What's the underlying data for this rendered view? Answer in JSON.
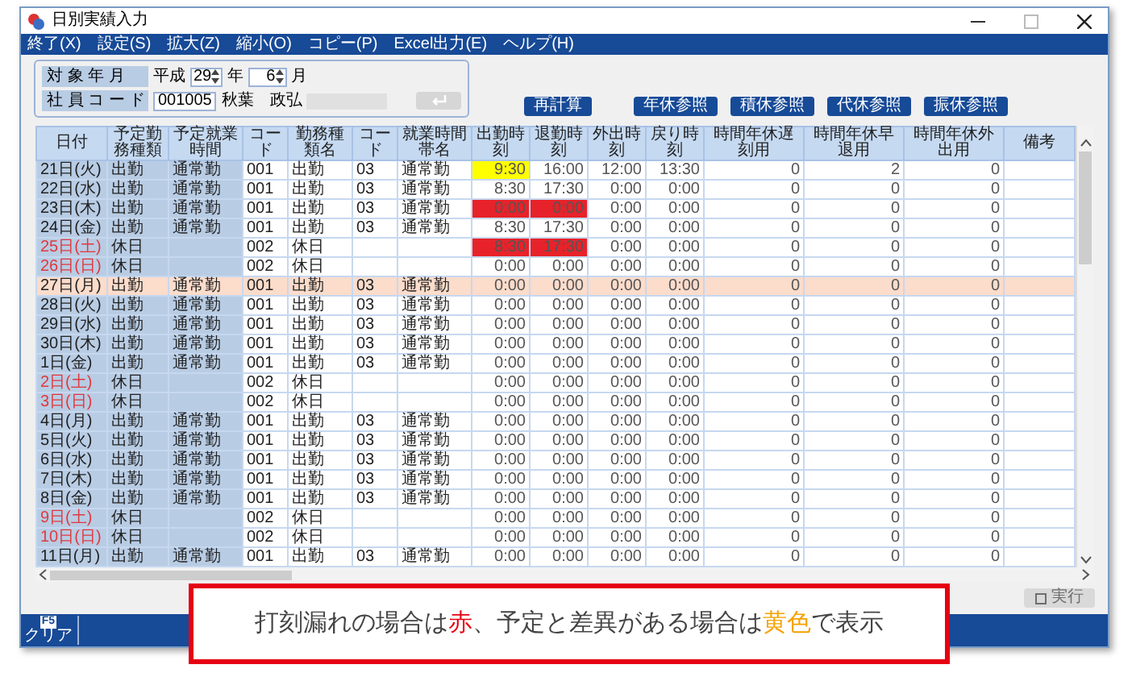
{
  "window": {
    "title": "日別実績入力"
  },
  "menu": [
    "終了(X)",
    "設定(S)",
    "拡大(Z)",
    "縮小(O)",
    "コピー(P)",
    "Excel出力(E)",
    "ヘルプ(H)"
  ],
  "form": {
    "period_label": "対 象 年 月",
    "era": "平成",
    "year": "29",
    "year_unit": "年",
    "month": "6",
    "month_unit": "月",
    "employee_label": "社 員 コ ー ド",
    "employee_code": "001005",
    "employee_name": "秋葉　政弘",
    "enter_button": {
      "disabled": true
    }
  },
  "recalc_button": {
    "label": "再計算"
  },
  "reference_buttons": [
    {
      "label": "年休参照"
    },
    {
      "label": "積休参照"
    },
    {
      "label": "代休参照"
    },
    {
      "label": "振休参照"
    }
  ],
  "table": {
    "columns": [
      "日付",
      "予定勤務種類",
      "予定就業時間",
      "コード",
      "勤務種類名",
      "コード",
      "就業時間帯名",
      "出勤時刻",
      "退勤時刻",
      "外出時刻",
      "戻り時刻",
      "時間年休遅刻用",
      "時間年休早退用",
      "時間年休外出用",
      "備考"
    ],
    "rows": [
      {
        "date": "21日(火)",
        "holiday": false,
        "selected": false,
        "plan_type": "出勤",
        "plan_hours": "通常勤",
        "code": "001",
        "type_name": "出勤",
        "hours_code": "03",
        "hours_name": "通常勤",
        "clock_in": "9:30",
        "clock_in_mismatch": true,
        "clock_out": "16:00",
        "out_time": "12:00",
        "return_time": "13:30",
        "late": "0",
        "early": "2",
        "outing": "0"
      },
      {
        "date": "22日(水)",
        "holiday": false,
        "selected": false,
        "plan_type": "出勤",
        "plan_hours": "通常勤",
        "code": "001",
        "type_name": "出勤",
        "hours_code": "03",
        "hours_name": "通常勤",
        "clock_in": "8:30",
        "clock_out": "17:30",
        "out_time": "0:00",
        "return_time": "0:00",
        "late": "0",
        "early": "0",
        "outing": "0"
      },
      {
        "date": "23日(木)",
        "holiday": false,
        "selected": false,
        "plan_type": "出勤",
        "plan_hours": "通常勤",
        "code": "001",
        "type_name": "出勤",
        "hours_code": "03",
        "hours_name": "通常勤",
        "clock_in": "0:00",
        "clock_in_missing": true,
        "clock_out": "0:00",
        "clock_out_missing": true,
        "out_time": "0:00",
        "return_time": "0:00",
        "late": "0",
        "early": "0",
        "outing": "0"
      },
      {
        "date": "24日(金)",
        "holiday": false,
        "selected": false,
        "plan_type": "出勤",
        "plan_hours": "通常勤",
        "code": "001",
        "type_name": "出勤",
        "hours_code": "03",
        "hours_name": "通常勤",
        "clock_in": "8:30",
        "clock_out": "17:30",
        "out_time": "0:00",
        "return_time": "0:00",
        "late": "0",
        "early": "0",
        "outing": "0"
      },
      {
        "date": "25日(土)",
        "holiday": true,
        "selected": false,
        "plan_type": "休日",
        "code": "002",
        "type_name": "休日",
        "clock_in": "8:30",
        "clock_in_missing": true,
        "clock_out": "17:30",
        "clock_out_missing": true,
        "out_time": "0:00",
        "return_time": "0:00",
        "late": "0",
        "early": "0",
        "outing": "0"
      },
      {
        "date": "26日(日)",
        "holiday": true,
        "selected": false,
        "plan_type": "休日",
        "code": "002",
        "type_name": "休日",
        "clock_in": "0:00",
        "clock_out": "0:00",
        "out_time": "0:00",
        "return_time": "0:00",
        "late": "0",
        "early": "0",
        "outing": "0"
      },
      {
        "date": "27日(月)",
        "holiday": false,
        "selected": true,
        "plan_type": "出勤",
        "plan_hours": "通常勤",
        "code": "001",
        "type_name": "出勤",
        "hours_code": "03",
        "hours_name": "通常勤",
        "clock_in": "0:00",
        "clock_out": "0:00",
        "out_time": "0:00",
        "return_time": "0:00",
        "late": "0",
        "early": "0",
        "outing": "0"
      },
      {
        "date": "28日(火)",
        "holiday": false,
        "selected": false,
        "plan_type": "出勤",
        "plan_hours": "通常勤",
        "code": "001",
        "type_name": "出勤",
        "hours_code": "03",
        "hours_name": "通常勤",
        "clock_in": "0:00",
        "clock_out": "0:00",
        "out_time": "0:00",
        "return_time": "0:00",
        "late": "0",
        "early": "0",
        "outing": "0"
      },
      {
        "date": "29日(水)",
        "holiday": false,
        "selected": false,
        "plan_type": "出勤",
        "plan_hours": "通常勤",
        "code": "001",
        "type_name": "出勤",
        "hours_code": "03",
        "hours_name": "通常勤",
        "clock_in": "0:00",
        "clock_out": "0:00",
        "out_time": "0:00",
        "return_time": "0:00",
        "late": "0",
        "early": "0",
        "outing": "0"
      },
      {
        "date": "30日(木)",
        "holiday": false,
        "selected": false,
        "plan_type": "出勤",
        "plan_hours": "通常勤",
        "code": "001",
        "type_name": "出勤",
        "hours_code": "03",
        "hours_name": "通常勤",
        "clock_in": "0:00",
        "clock_out": "0:00",
        "out_time": "0:00",
        "return_time": "0:00",
        "late": "0",
        "early": "0",
        "outing": "0"
      },
      {
        "date": "1日(金)",
        "holiday": false,
        "selected": false,
        "plan_type": "出勤",
        "plan_hours": "通常勤",
        "code": "001",
        "type_name": "出勤",
        "hours_code": "03",
        "hours_name": "通常勤",
        "clock_in": "0:00",
        "clock_out": "0:00",
        "out_time": "0:00",
        "return_time": "0:00",
        "late": "0",
        "early": "0",
        "outing": "0"
      },
      {
        "date": "2日(土)",
        "holiday": true,
        "selected": false,
        "plan_type": "休日",
        "code": "002",
        "type_name": "休日",
        "clock_in": "0:00",
        "clock_out": "0:00",
        "out_time": "0:00",
        "return_time": "0:00",
        "late": "0",
        "early": "0",
        "outing": "0"
      },
      {
        "date": "3日(日)",
        "holiday": true,
        "selected": false,
        "plan_type": "休日",
        "code": "002",
        "type_name": "休日",
        "clock_in": "0:00",
        "clock_out": "0:00",
        "out_time": "0:00",
        "return_time": "0:00",
        "late": "0",
        "early": "0",
        "outing": "0"
      },
      {
        "date": "4日(月)",
        "holiday": false,
        "selected": false,
        "plan_type": "出勤",
        "plan_hours": "通常勤",
        "code": "001",
        "type_name": "出勤",
        "hours_code": "03",
        "hours_name": "通常勤",
        "clock_in": "0:00",
        "clock_out": "0:00",
        "out_time": "0:00",
        "return_time": "0:00",
        "late": "0",
        "early": "0",
        "outing": "0"
      },
      {
        "date": "5日(火)",
        "holiday": false,
        "selected": false,
        "plan_type": "出勤",
        "plan_hours": "通常勤",
        "code": "001",
        "type_name": "出勤",
        "hours_code": "03",
        "hours_name": "通常勤",
        "clock_in": "0:00",
        "clock_out": "0:00",
        "out_time": "0:00",
        "return_time": "0:00",
        "late": "0",
        "early": "0",
        "outing": "0"
      },
      {
        "date": "6日(水)",
        "holiday": false,
        "selected": false,
        "plan_type": "出勤",
        "plan_hours": "通常勤",
        "code": "001",
        "type_name": "出勤",
        "hours_code": "03",
        "hours_name": "通常勤",
        "clock_in": "0:00",
        "clock_out": "0:00",
        "out_time": "0:00",
        "return_time": "0:00",
        "late": "0",
        "early": "0",
        "outing": "0"
      },
      {
        "date": "7日(木)",
        "holiday": false,
        "selected": false,
        "plan_type": "出勤",
        "plan_hours": "通常勤",
        "code": "001",
        "type_name": "出勤",
        "hours_code": "03",
        "hours_name": "通常勤",
        "clock_in": "0:00",
        "clock_out": "0:00",
        "out_time": "0:00",
        "return_time": "0:00",
        "late": "0",
        "early": "0",
        "outing": "0"
      },
      {
        "date": "8日(金)",
        "holiday": false,
        "selected": false,
        "plan_type": "出勤",
        "plan_hours": "通常勤",
        "code": "001",
        "type_name": "出勤",
        "hours_code": "03",
        "hours_name": "通常勤",
        "clock_in": "0:00",
        "clock_out": "0:00",
        "out_time": "0:00",
        "return_time": "0:00",
        "late": "0",
        "early": "0",
        "outing": "0"
      },
      {
        "date": "9日(土)",
        "holiday": true,
        "selected": false,
        "plan_type": "休日",
        "code": "002",
        "type_name": "休日",
        "clock_in": "0:00",
        "clock_out": "0:00",
        "out_time": "0:00",
        "return_time": "0:00",
        "late": "0",
        "early": "0",
        "outing": "0"
      },
      {
        "date": "10日(日)",
        "holiday": true,
        "selected": false,
        "plan_type": "休日",
        "code": "002",
        "type_name": "休日",
        "clock_in": "0:00",
        "clock_out": "0:00",
        "out_time": "0:00",
        "return_time": "0:00",
        "late": "0",
        "early": "0",
        "outing": "0"
      },
      {
        "date": "11日(月)",
        "holiday": false,
        "selected": false,
        "plan_type": "出勤",
        "plan_hours": "通常勤",
        "code": "001",
        "type_name": "出勤",
        "hours_code": "03",
        "hours_name": "通常勤",
        "clock_in": "0:00",
        "clock_out": "0:00",
        "out_time": "0:00",
        "return_time": "0:00",
        "late": "0",
        "early": "0",
        "outing": "0"
      }
    ]
  },
  "run_button": {
    "label": "実行",
    "disabled": true
  },
  "function_keys": [
    {
      "key": "F5",
      "label": "クリア"
    }
  ],
  "callout": [
    {
      "text": "打刻漏れの場合は"
    },
    {
      "text": "赤",
      "color": "#e60012"
    },
    {
      "text": "、予定と差異がある場合は"
    },
    {
      "text": "黄色",
      "color": "#f5a200"
    },
    {
      "text": "で表示"
    }
  ]
}
